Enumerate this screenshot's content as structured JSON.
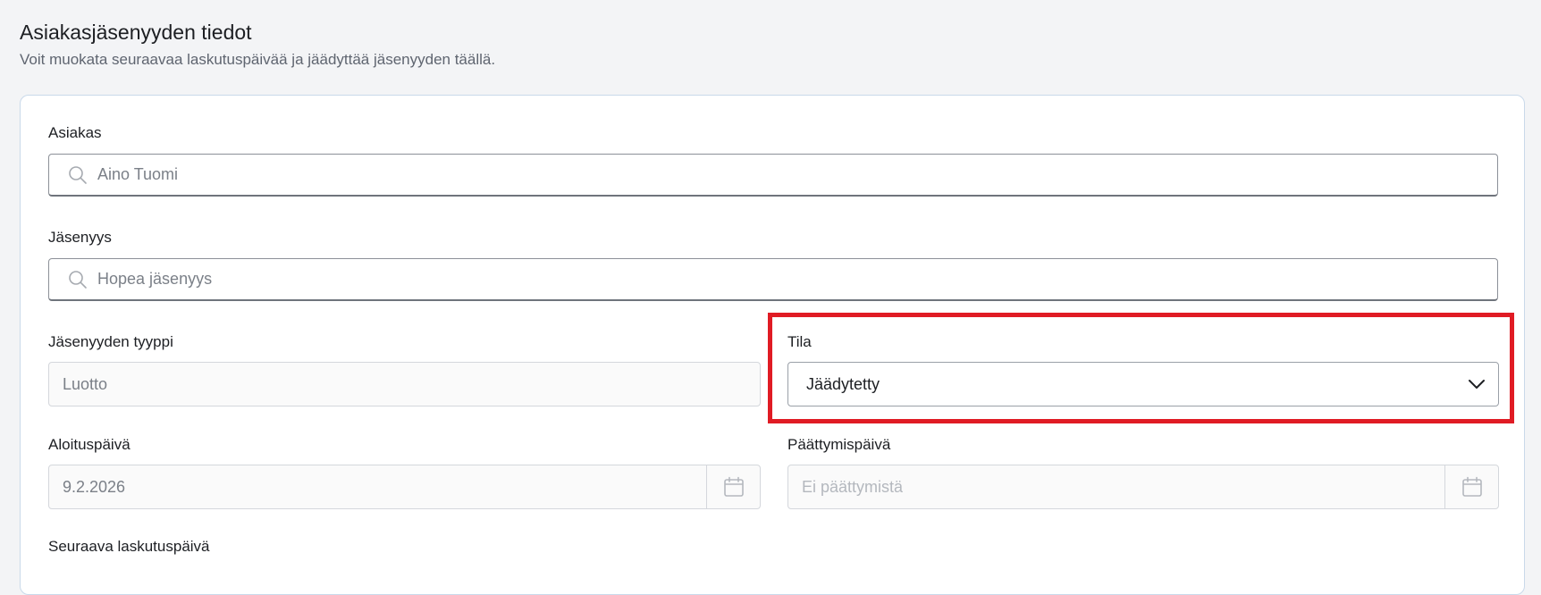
{
  "header": {
    "title": "Asiakasjäsenyyden tiedot",
    "subtitle": "Voit muokata seuraavaa laskutuspäivää ja jäädyttää jäsenyyden täällä."
  },
  "form": {
    "customer": {
      "label": "Asiakas",
      "value": "Aino Tuomi",
      "icon": "search-icon"
    },
    "membership": {
      "label": "Jäsenyys",
      "value": "Hopea jäsenyys",
      "icon": "search-icon"
    },
    "membership_type": {
      "label": "Jäsenyyden tyyppi",
      "value": "Luotto"
    },
    "status": {
      "label": "Tila",
      "value": "Jäädytetty",
      "icon": "chevron-down-icon"
    },
    "start_date": {
      "label": "Aloituspäivä",
      "value": "9.2.2026",
      "icon": "calendar-icon"
    },
    "end_date": {
      "label": "Päättymispäivä",
      "placeholder": "Ei päättymistä",
      "icon": "calendar-icon"
    },
    "next_billing_date": {
      "label": "Seuraava laskutuspäivä"
    }
  },
  "colors": {
    "highlight": "#e01b24",
    "card_border": "#c9d9ea",
    "background": "#f3f4f6"
  }
}
